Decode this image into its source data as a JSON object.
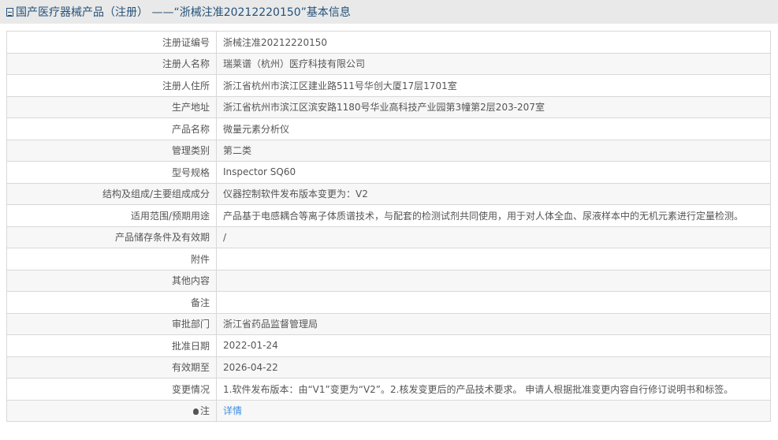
{
  "header": {
    "title": "国产医疗器械产品（注册） ——“浙械注准20212220150”基本信息"
  },
  "rows": [
    {
      "label": "注册证编号",
      "value": "浙械注准20212220150"
    },
    {
      "label": "注册人名称",
      "value": "瑞莱谱（杭州）医疗科技有限公司"
    },
    {
      "label": "注册人住所",
      "value": "浙江省杭州市滨江区建业路511号华创大厦17层1701室"
    },
    {
      "label": "生产地址",
      "value": "浙江省杭州市滨江区滨安路1180号华业高科技产业园第3幢第2层203-207室"
    },
    {
      "label": "产品名称",
      "value": "微量元素分析仪"
    },
    {
      "label": "管理类别",
      "value": "第二类"
    },
    {
      "label": "型号规格",
      "value": "Inspector SQ60"
    },
    {
      "label": "结构及组成/主要组成成分",
      "value": "仪器控制软件发布版本变更为：V2"
    },
    {
      "label": "适用范围/预期用途",
      "value": "产品基于电感耦合等离子体质谱技术，与配套的检测试剂共同使用，用于对人体全血、尿液样本中的无机元素进行定量检测。"
    },
    {
      "label": "产品储存条件及有效期",
      "value": "/"
    },
    {
      "label": "附件",
      "value": ""
    },
    {
      "label": "其他内容",
      "value": ""
    },
    {
      "label": "备注",
      "value": ""
    },
    {
      "label": "审批部门",
      "value": "浙江省药品监督管理局"
    },
    {
      "label": "批准日期",
      "value": "2022-01-24"
    },
    {
      "label": "有效期至",
      "value": "2026-04-22"
    },
    {
      "label": "变更情况",
      "value": "1.软件发布版本：由“V1”变更为“V2”。2.核发变更后的产品技术要求。 申请人根据批准变更内容自行修订说明书和标签。"
    }
  ],
  "note": {
    "label": "注",
    "link": "详情"
  }
}
